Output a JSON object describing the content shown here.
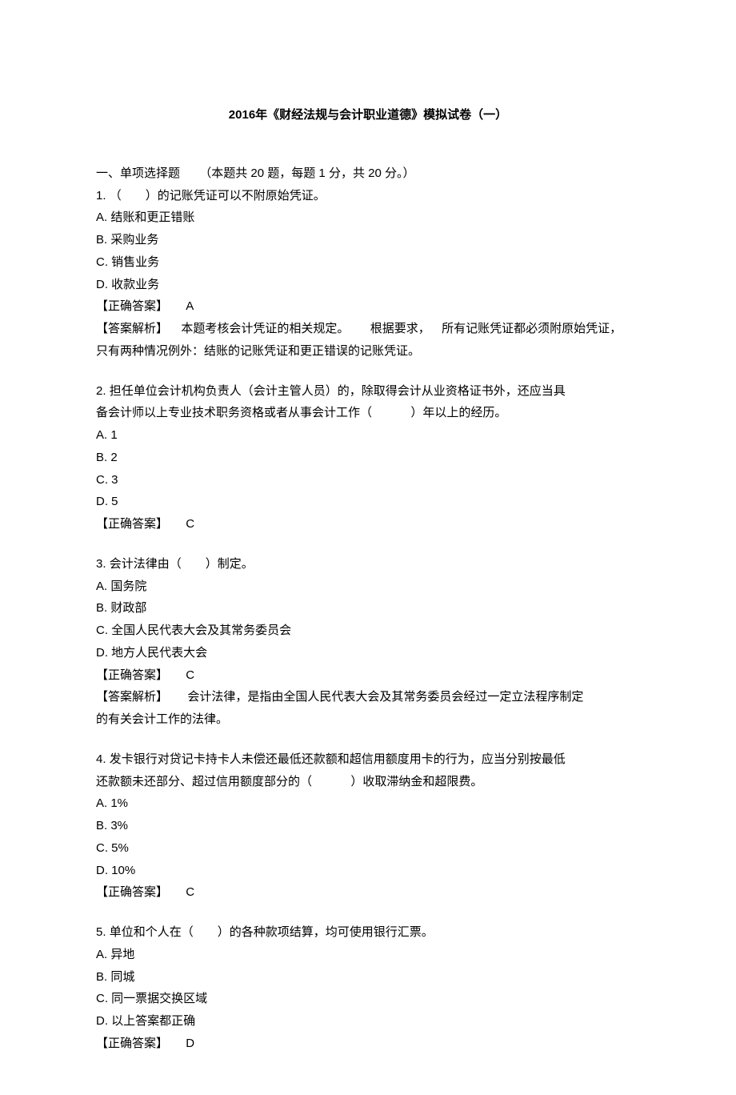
{
  "title": {
    "year": "2016",
    "text": "年《财经法规与会计职业道德》模拟试卷（一）"
  },
  "section": {
    "label": "一、单项选择题",
    "desc_p1": "（本题共",
    "desc_n1": "20",
    "desc_p2": "题，每题",
    "desc_n2": "1",
    "desc_p3": "分，共",
    "desc_n3": "20",
    "desc_p4": "分。）"
  },
  "q1": {
    "num": "1.",
    "stem": "（　　）的记账凭证可以不附原始凭证。",
    "A": "A. 结账和更正错账",
    "B": "B. 采购业务",
    "C": "C. 销售业务",
    "D": "D. 收款业务",
    "ans_label": "【正确答案】",
    "ans_letter": "A",
    "expl_label": "【答案解析】",
    "expl_p1": "本题考核会计凭证的相关规定。",
    "expl_p2": "根据要求，",
    "expl_p3": "所有记账凭证都必须附原始凭证，",
    "expl_line2": "只有两种情况例外：结账的记账凭证和更正错误的记账凭证。"
  },
  "q2": {
    "num": "2.",
    "stem_l1": "担任单位会计机构负责人（会计主管人员）的，除取得会计从业资格证书外，还应当具",
    "stem_l2_a": "备会计师以上专业技术职务资格或者从事会计工作（",
    "stem_l2_b": "）年以上的经历。",
    "A": "A. 1",
    "B": "B. 2",
    "C": "C. 3",
    "D": "D. 5",
    "ans_label": "【正确答案】",
    "ans_letter": "C"
  },
  "q3": {
    "num": "3.",
    "stem": "会计法律由（　　）制定。",
    "A": "A. 国务院",
    "B": "B. 财政部",
    "C": "C. 全国人民代表大会及其常务委员会",
    "D": "D. 地方人民代表大会",
    "ans_label": "【正确答案】",
    "ans_letter": "C",
    "expl_label": "【答案解析】",
    "expl_p1": "会计法律，是指由全国人民代表大会及其常务委员会经过一定立法程序制定",
    "expl_line2": "的有关会计工作的法律。"
  },
  "q4": {
    "num": "4.",
    "stem_l1": "发卡银行对贷记卡持卡人未偿还最低还款额和超信用额度用卡的行为，应当分别按最低",
    "stem_l2_a": "还款额未还部分、超过信用额度部分的（",
    "stem_l2_b": "）收取滞纳金和超限费。",
    "A": "A. 1%",
    "B": "B. 3%",
    "C": "C. 5%",
    "D": "D. 10%",
    "ans_label": "【正确答案】",
    "ans_letter": "C"
  },
  "q5": {
    "num": "5.",
    "stem": "单位和个人在（　　）的各种款项结算，均可使用银行汇票。",
    "A": "A. 异地",
    "B": "B. 同城",
    "C": "C. 同一票据交换区域",
    "D": "D. 以上答案都正确",
    "ans_label": "【正确答案】",
    "ans_letter": "D"
  }
}
